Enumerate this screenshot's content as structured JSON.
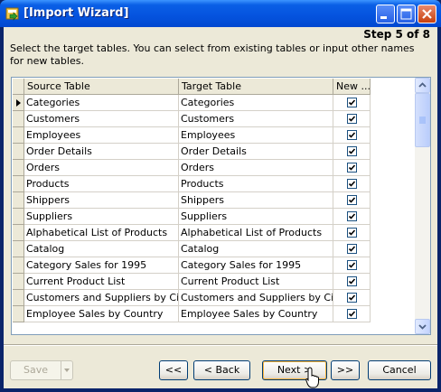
{
  "window": {
    "title": "[Import Wizard]"
  },
  "wizard": {
    "step": "Step 5 of 8",
    "instruction": "Select the target tables. You can select from existing tables or input other names for new tables."
  },
  "grid": {
    "columns": {
      "source": "Source Table",
      "target": "Target Table",
      "new": "New ..."
    },
    "rows": [
      {
        "source": "Categories",
        "target": "Categories",
        "new": true
      },
      {
        "source": "Customers",
        "target": "Customers",
        "new": true
      },
      {
        "source": "Employees",
        "target": "Employees",
        "new": true
      },
      {
        "source": "Order Details",
        "target": "Order Details",
        "new": true
      },
      {
        "source": "Orders",
        "target": "Orders",
        "new": true
      },
      {
        "source": "Products",
        "target": "Products",
        "new": true
      },
      {
        "source": "Shippers",
        "target": "Shippers",
        "new": true
      },
      {
        "source": "Suppliers",
        "target": "Suppliers",
        "new": true
      },
      {
        "source": "Alphabetical List of Products",
        "target": "Alphabetical List of Products",
        "new": true
      },
      {
        "source": "Catalog",
        "target": "Catalog",
        "new": true
      },
      {
        "source": "Category Sales for 1995",
        "target": "Category Sales for 1995",
        "new": true
      },
      {
        "source": "Current Product List",
        "target": "Current Product List",
        "new": true
      },
      {
        "source": "Customers and Suppliers by City",
        "target": "Customers and Suppliers by City",
        "new": true
      },
      {
        "source": "Employee Sales by Country",
        "target": "Employee Sales by Country",
        "new": true
      }
    ]
  },
  "buttons": {
    "save": "Save",
    "first": "<<",
    "back": "< Back",
    "next": "Next >",
    "last": ">>",
    "cancel": "Cancel"
  }
}
